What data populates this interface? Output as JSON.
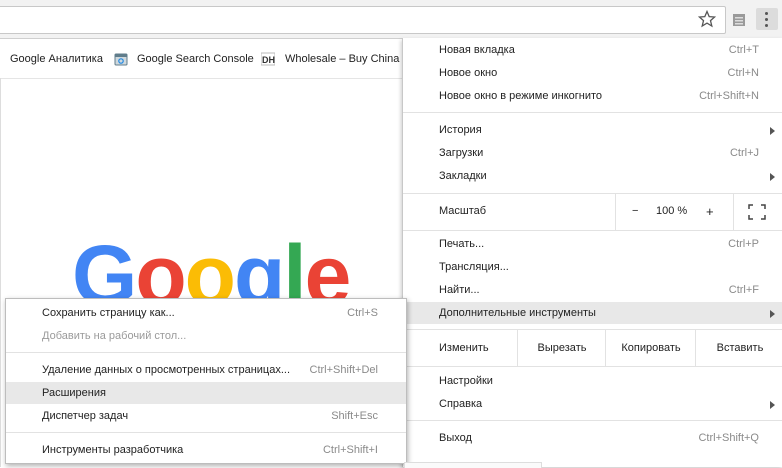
{
  "toolbar": {
    "star_icon": "star-icon",
    "extension_icon": "extension-icon",
    "menu_icon": "kebab-icon"
  },
  "bookmarks": [
    {
      "label": "Google Аналитика",
      "icon": "analytics-icon"
    },
    {
      "label": "Google Search Console",
      "icon": "search-console-icon"
    },
    {
      "label": "Wholesale – Buy China",
      "icon": "dh-icon"
    }
  ],
  "logo": {
    "text": "Google",
    "colors": [
      "#4285F4",
      "#EA4335",
      "#FBBC05",
      "#4285F4",
      "#34A853",
      "#EA4335"
    ]
  },
  "menu": {
    "new_tab": {
      "label": "Новая вкладка",
      "shortcut": "Ctrl+T"
    },
    "new_window": {
      "label": "Новое окно",
      "shortcut": "Ctrl+N"
    },
    "incognito": {
      "label": "Новое окно в режиме инкогнито",
      "shortcut": "Ctrl+Shift+N"
    },
    "history": {
      "label": "История"
    },
    "downloads": {
      "label": "Загрузки",
      "shortcut": "Ctrl+J"
    },
    "bookmarks": {
      "label": "Закладки"
    },
    "zoom": {
      "label": "Масштаб",
      "minus": "−",
      "value": "100 %",
      "plus": "+"
    },
    "print": {
      "label": "Печать...",
      "shortcut": "Ctrl+P"
    },
    "cast": {
      "label": "Трансляция..."
    },
    "find": {
      "label": "Найти...",
      "shortcut": "Ctrl+F"
    },
    "more_tools": {
      "label": "Дополнительные инструменты"
    },
    "edit": {
      "label": "Изменить",
      "cut": "Вырезать",
      "copy": "Копировать",
      "paste": "Вставить"
    },
    "settings": {
      "label": "Настройки"
    },
    "help": {
      "label": "Справка"
    },
    "exit": {
      "label": "Выход",
      "shortcut": "Ctrl+Shift+Q"
    }
  },
  "submenu": {
    "save_page": {
      "label": "Сохранить страницу как...",
      "shortcut": "Ctrl+S"
    },
    "add_desktop": {
      "label": "Добавить на рабочий стол..."
    },
    "clear_data": {
      "label": "Удаление данных о просмотренных страницах...",
      "shortcut": "Ctrl+Shift+Del"
    },
    "extensions": {
      "label": "Расширения"
    },
    "task_manager": {
      "label": "Диспетчер задач",
      "shortcut": "Shift+Esc"
    },
    "devtools": {
      "label": "Инструменты разработчика",
      "shortcut": "Ctrl+Shift+I"
    }
  }
}
